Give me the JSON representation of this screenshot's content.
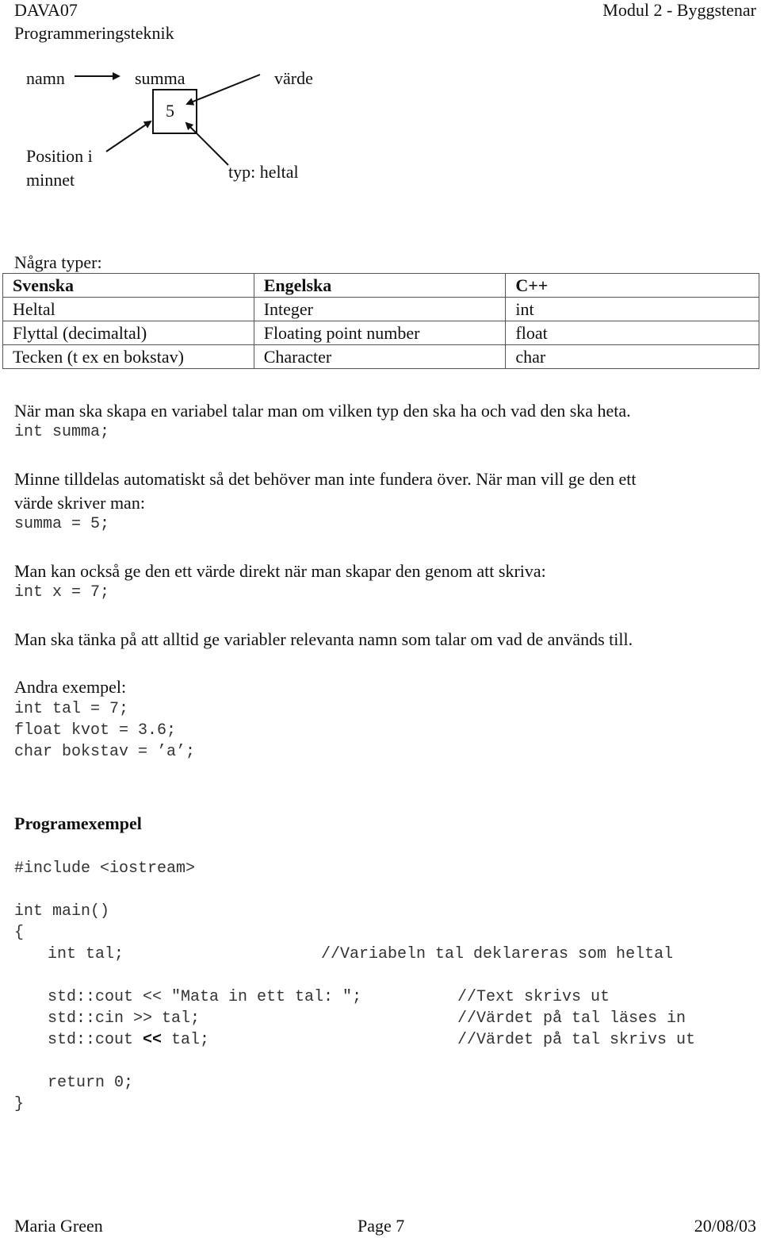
{
  "header": {
    "course_code": "DAVA07",
    "course_name": "Programmeringsteknik",
    "module": "Modul 2 - Byggstenar"
  },
  "diagram": {
    "name_label": "namn",
    "variable_name": "summa",
    "value_label": "värde",
    "value": "5",
    "position_label_line1": "Position i",
    "position_label_line2": "minnet",
    "type_label": "typ: heltal"
  },
  "types_section": {
    "heading": "Några typer:",
    "columns": [
      "Svenska",
      "Engelska",
      "C++"
    ],
    "rows": [
      [
        "Heltal",
        "Integer",
        "int"
      ],
      [
        "Flyttal (decimaltal)",
        "Floating point number",
        "float"
      ],
      [
        "Tecken (t ex en bokstav)",
        "Character",
        "char"
      ]
    ]
  },
  "body": {
    "p1": "När man ska skapa en variabel talar man om vilken typ den ska ha och vad den ska heta.",
    "code1": "int summa;",
    "p2_line1": "Minne tilldelas automatiskt så det behöver man inte fundera över. När man vill ge den ett",
    "p2_line2": "värde skriver man:",
    "code2": "summa = 5;",
    "p3": "Man kan också ge den ett värde direkt när man skapar den genom att skriva:",
    "code3": "int x = 7;",
    "p4": "Man ska tänka på att alltid ge variabler relevanta namn som talar om vad de används till.",
    "p5": "Andra exempel:",
    "examples": [
      "int tal = 7;",
      "float kvot = 3.6;",
      "char bokstav = ’a’;"
    ]
  },
  "program_example": {
    "heading": "Programexempel",
    "include": "#include <iostream>",
    "main_sig": "int main()",
    "open_brace": "{",
    "decl": "int tal;",
    "decl_comment": "//Variabeln tal deklareras som heltal",
    "lines": [
      {
        "code": "std::cout << \"Mata in ett tal: \";",
        "comment": "//Text skrivs ut"
      },
      {
        "code": "std::cin >> tal;",
        "comment": "//Värdet på tal läses in"
      },
      {
        "code_prefix": "std::cout ",
        "code_op": "<<",
        "code_suffix": " tal;",
        "comment": "//Värdet på tal skrivs ut"
      }
    ],
    "return_stmt": "return 0;",
    "close_brace": "}"
  },
  "footer": {
    "author": "Maria Green",
    "page": "Page 7",
    "date": "20/08/03"
  }
}
